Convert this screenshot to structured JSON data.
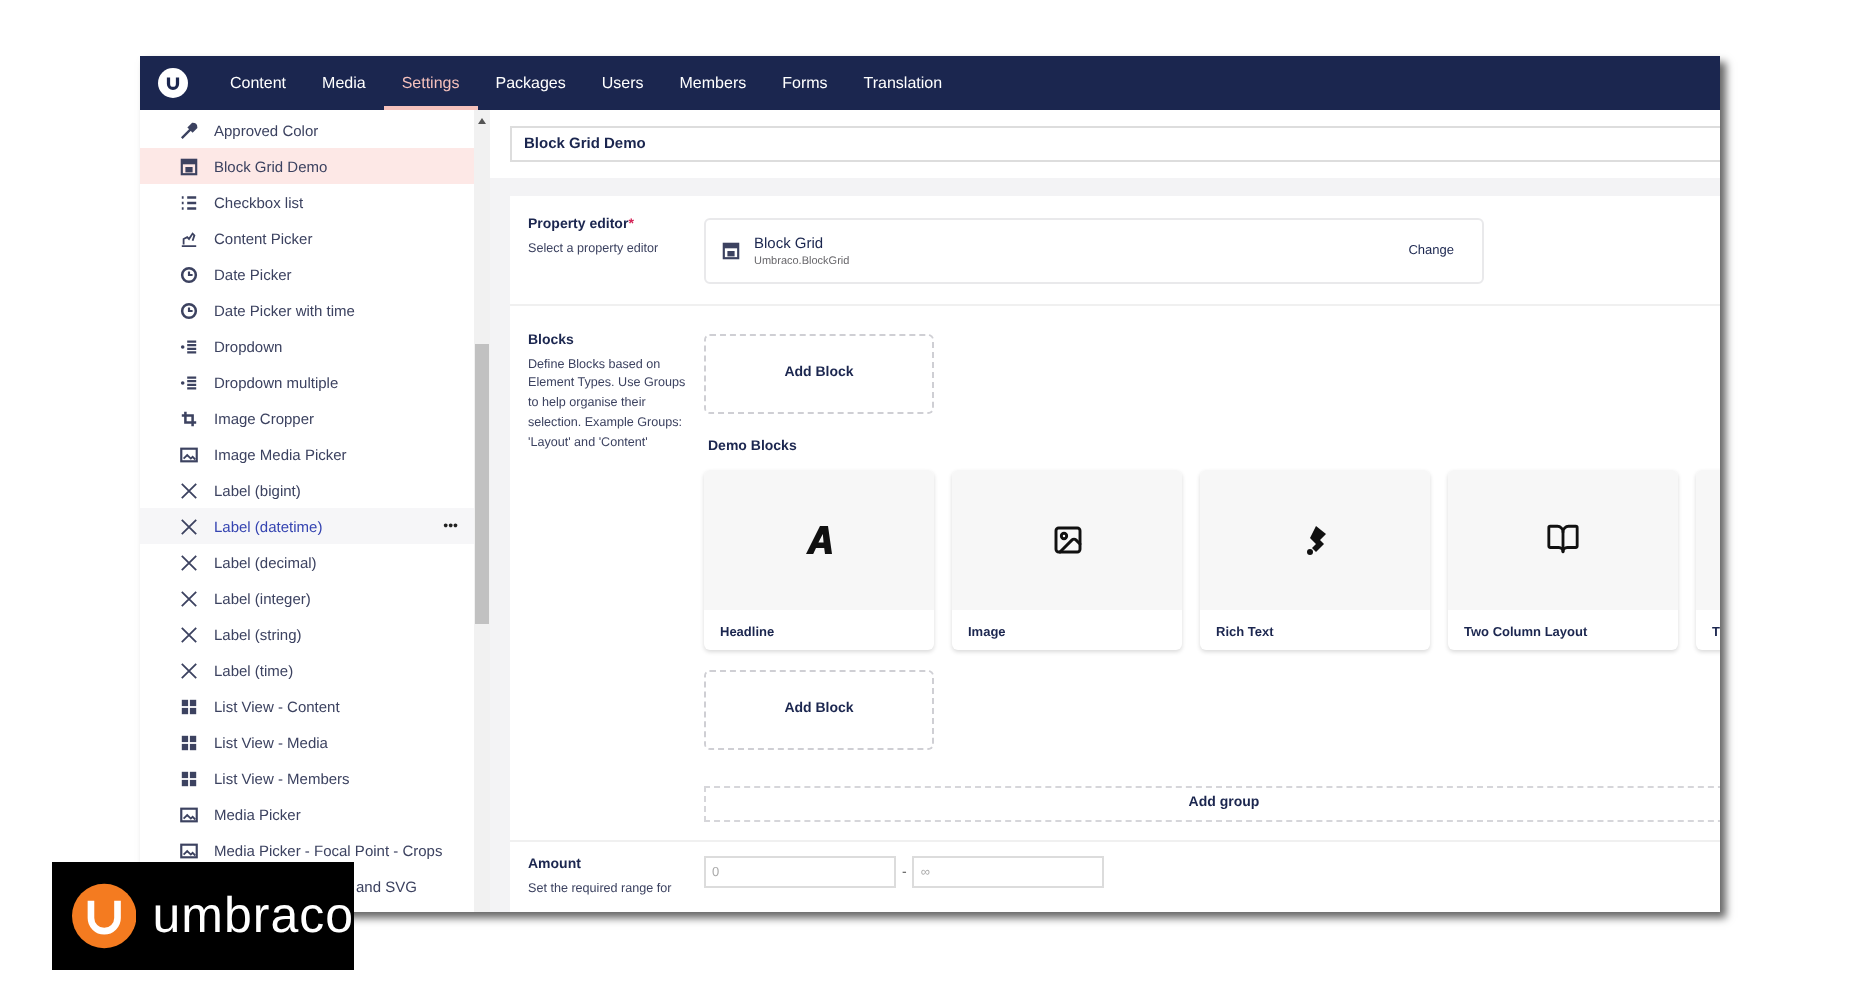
{
  "header": {
    "sections": [
      {
        "label": "Content",
        "selected": false
      },
      {
        "label": "Media",
        "selected": false
      },
      {
        "label": "Settings",
        "selected": true
      },
      {
        "label": "Packages",
        "selected": false
      },
      {
        "label": "Users",
        "selected": false
      },
      {
        "label": "Members",
        "selected": false
      },
      {
        "label": "Forms",
        "selected": false
      },
      {
        "label": "Translation",
        "selected": false
      }
    ]
  },
  "sidebar": {
    "items": [
      {
        "label": "Approved Color",
        "kind": "eyedropper",
        "selected": false,
        "highlighted": false
      },
      {
        "label": "Block Grid Demo",
        "kind": "grid",
        "selected": true,
        "highlighted": false
      },
      {
        "label": "Checkbox list",
        "kind": "list",
        "selected": false,
        "highlighted": false
      },
      {
        "label": "Content Picker",
        "kind": "picker",
        "selected": false,
        "highlighted": false
      },
      {
        "label": "Date Picker",
        "kind": "clock",
        "selected": false,
        "highlighted": false
      },
      {
        "label": "Date Picker with time",
        "kind": "clock",
        "selected": false,
        "highlighted": false
      },
      {
        "label": "Dropdown",
        "kind": "dropdown",
        "selected": false,
        "highlighted": false
      },
      {
        "label": "Dropdown multiple",
        "kind": "dropdown",
        "selected": false,
        "highlighted": false
      },
      {
        "label": "Image Cropper",
        "kind": "crop",
        "selected": false,
        "highlighted": false
      },
      {
        "label": "Image Media Picker",
        "kind": "image",
        "selected": false,
        "highlighted": false
      },
      {
        "label": "Label (bigint)",
        "kind": "label",
        "selected": false,
        "highlighted": false
      },
      {
        "label": "Label (datetime)",
        "kind": "label",
        "selected": false,
        "highlighted": true,
        "actions": "•••"
      },
      {
        "label": "Label (decimal)",
        "kind": "label",
        "selected": false,
        "highlighted": false
      },
      {
        "label": "Label (integer)",
        "kind": "label",
        "selected": false,
        "highlighted": false
      },
      {
        "label": "Label (string)",
        "kind": "label",
        "selected": false,
        "highlighted": false
      },
      {
        "label": "Label (time)",
        "kind": "label",
        "selected": false,
        "highlighted": false
      },
      {
        "label": "List View - Content",
        "kind": "listview",
        "selected": false,
        "highlighted": false
      },
      {
        "label": "List View - Media",
        "kind": "listview",
        "selected": false,
        "highlighted": false
      },
      {
        "label": "List View - Members",
        "kind": "listview",
        "selected": false,
        "highlighted": false
      },
      {
        "label": "Media Picker",
        "kind": "image",
        "selected": false,
        "highlighted": false
      },
      {
        "label": "Media Picker - Focal Point - Crops",
        "kind": "image",
        "selected": false,
        "highlighted": false
      },
      {
        "label": "and SVG",
        "kind": "covered",
        "selected": false,
        "highlighted": false
      }
    ]
  },
  "name_field": {
    "value": "Block Grid Demo"
  },
  "property_editor": {
    "label": "Property editor",
    "required_mark": "*",
    "description": "Select a property editor",
    "editor_name": "Block Grid",
    "editor_alias": "Umbraco.BlockGrid",
    "change": "Change"
  },
  "blocks": {
    "label": "Blocks",
    "description": "Define Blocks based on Element Types. Use Groups to help organise their selection. Example Groups: 'Layout' and 'Content'",
    "add_block_top": "Add Block",
    "group_title": "Demo Blocks",
    "cards": [
      {
        "label": "Headline",
        "kind": "headline"
      },
      {
        "label": "Image",
        "kind": "image"
      },
      {
        "label": "Rich Text",
        "kind": "richtext"
      },
      {
        "label": "Two Column Layout",
        "kind": "layout"
      },
      {
        "label": "T",
        "kind": "blank"
      }
    ],
    "add_block_bottom": "Add Block",
    "add_group": "Add group"
  },
  "amount": {
    "label": "Amount",
    "description": "Set the required range for",
    "min_placeholder": "0",
    "separator": "-",
    "max_placeholder": "∞"
  },
  "logo_badge": {
    "text": "umbraco"
  }
}
